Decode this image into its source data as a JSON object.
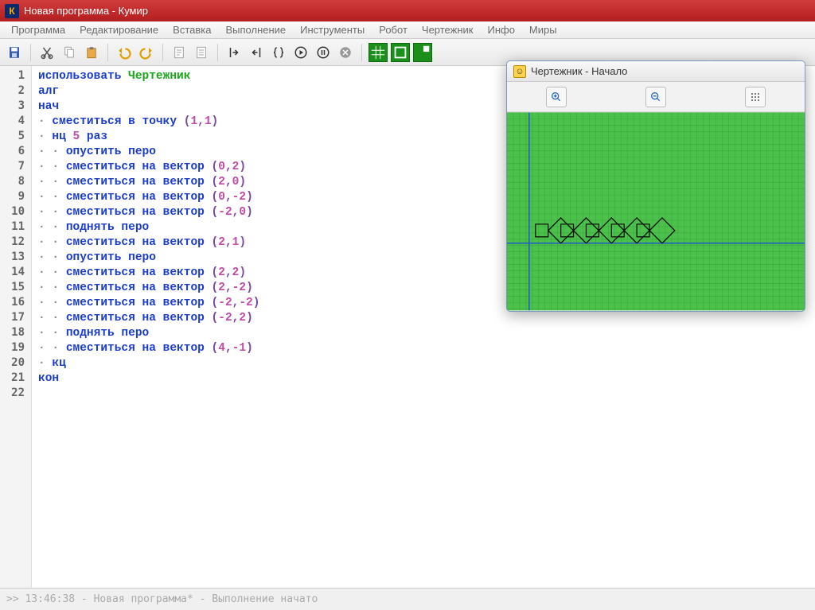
{
  "window": {
    "title": "Новая программа - Кумир",
    "icon_letter": "К"
  },
  "menu": {
    "items": [
      "Программа",
      "Редактирование",
      "Вставка",
      "Выполнение",
      "Инструменты",
      "Робот",
      "Чертежник",
      "Инфо",
      "Миры"
    ]
  },
  "toolbar": {
    "icons": [
      "save",
      "cut",
      "copy",
      "paste",
      "undo",
      "redo",
      "indent",
      "outdent",
      "step-in",
      "step-out",
      "braces",
      "run",
      "stop",
      "cancel"
    ],
    "green_icons": [
      "grid",
      "border",
      "fill"
    ]
  },
  "code": {
    "lines": [
      {
        "n": 1,
        "raw": [
          [
            "kw",
            "использовать "
          ],
          [
            "id",
            "Чертежник"
          ]
        ]
      },
      {
        "n": 2,
        "raw": [
          [
            "kw",
            "алг"
          ]
        ]
      },
      {
        "n": 3,
        "raw": [
          [
            "kw",
            "нач"
          ]
        ]
      },
      {
        "n": 4,
        "raw": [
          [
            "dot",
            "· "
          ],
          [
            "kw",
            "сместиться в точку "
          ],
          [
            "pn",
            "("
          ],
          [
            "num",
            "1"
          ],
          [
            "pn",
            ","
          ],
          [
            "num",
            "1"
          ],
          [
            "pn",
            ")"
          ]
        ]
      },
      {
        "n": 5,
        "raw": [
          [
            "dot",
            "· "
          ],
          [
            "kw",
            "нц "
          ],
          [
            "num",
            "5"
          ],
          [
            "kw",
            " раз"
          ]
        ]
      },
      {
        "n": 6,
        "raw": [
          [
            "dot",
            "· · "
          ],
          [
            "kw",
            "опустить перо"
          ]
        ]
      },
      {
        "n": 7,
        "raw": [
          [
            "dot",
            "· · "
          ],
          [
            "kw",
            "сместиться на вектор "
          ],
          [
            "pn",
            "("
          ],
          [
            "num",
            "0"
          ],
          [
            "pn",
            ","
          ],
          [
            "num",
            "2"
          ],
          [
            "pn",
            ")"
          ]
        ]
      },
      {
        "n": 8,
        "raw": [
          [
            "dot",
            "· · "
          ],
          [
            "kw",
            "сместиться на вектор "
          ],
          [
            "pn",
            "("
          ],
          [
            "num",
            "2"
          ],
          [
            "pn",
            ","
          ],
          [
            "num",
            "0"
          ],
          [
            "pn",
            ")"
          ]
        ]
      },
      {
        "n": 9,
        "raw": [
          [
            "dot",
            "· · "
          ],
          [
            "kw",
            "сместиться на вектор "
          ],
          [
            "pn",
            "("
          ],
          [
            "num",
            "0"
          ],
          [
            "pn",
            ","
          ],
          [
            "num",
            "-2"
          ],
          [
            "pn",
            ")"
          ]
        ]
      },
      {
        "n": 10,
        "raw": [
          [
            "dot",
            "· · "
          ],
          [
            "kw",
            "сместиться на вектор "
          ],
          [
            "pn",
            "("
          ],
          [
            "num",
            "-2"
          ],
          [
            "pn",
            ","
          ],
          [
            "num",
            "0"
          ],
          [
            "pn",
            ")"
          ]
        ]
      },
      {
        "n": 11,
        "raw": [
          [
            "dot",
            "· · "
          ],
          [
            "kw",
            "поднять перо"
          ]
        ]
      },
      {
        "n": 12,
        "raw": [
          [
            "dot",
            "· · "
          ],
          [
            "kw",
            "сместиться на вектор "
          ],
          [
            "pn",
            "("
          ],
          [
            "num",
            "2"
          ],
          [
            "pn",
            ","
          ],
          [
            "num",
            "1"
          ],
          [
            "pn",
            ")"
          ]
        ]
      },
      {
        "n": 13,
        "raw": [
          [
            "dot",
            "· · "
          ],
          [
            "kw",
            "опустить перо"
          ]
        ]
      },
      {
        "n": 14,
        "raw": [
          [
            "dot",
            "· · "
          ],
          [
            "kw",
            "сместиться на вектор "
          ],
          [
            "pn",
            "("
          ],
          [
            "num",
            "2"
          ],
          [
            "pn",
            ","
          ],
          [
            "num",
            "2"
          ],
          [
            "pn",
            ")"
          ]
        ]
      },
      {
        "n": 15,
        "raw": [
          [
            "dot",
            "· · "
          ],
          [
            "kw",
            "сместиться на вектор "
          ],
          [
            "pn",
            "("
          ],
          [
            "num",
            "2"
          ],
          [
            "pn",
            ","
          ],
          [
            "num",
            "-2"
          ],
          [
            "pn",
            ")"
          ]
        ]
      },
      {
        "n": 16,
        "raw": [
          [
            "dot",
            "· · "
          ],
          [
            "kw",
            "сместиться на вектор "
          ],
          [
            "pn",
            "("
          ],
          [
            "num",
            "-2"
          ],
          [
            "pn",
            ","
          ],
          [
            "num",
            "-2"
          ],
          [
            "pn",
            ")"
          ]
        ]
      },
      {
        "n": 17,
        "raw": [
          [
            "dot",
            "· · "
          ],
          [
            "kw",
            "сместиться на вектор "
          ],
          [
            "pn",
            "("
          ],
          [
            "num",
            "-2"
          ],
          [
            "pn",
            ","
          ],
          [
            "num",
            "2"
          ],
          [
            "pn",
            ")"
          ]
        ]
      },
      {
        "n": 18,
        "raw": [
          [
            "dot",
            "· · "
          ],
          [
            "kw",
            "поднять перо"
          ]
        ]
      },
      {
        "n": 19,
        "raw": [
          [
            "dot",
            "· · "
          ],
          [
            "kw",
            "сместиться на вектор "
          ],
          [
            "pn",
            "("
          ],
          [
            "num",
            "4"
          ],
          [
            "pn",
            ","
          ],
          [
            "num",
            "-1"
          ],
          [
            "pn",
            ")"
          ]
        ]
      },
      {
        "n": 20,
        "raw": [
          [
            "dot",
            "· "
          ],
          [
            "kw",
            "кц"
          ]
        ]
      },
      {
        "n": 21,
        "raw": [
          [
            "kw",
            "кон"
          ]
        ]
      },
      {
        "n": 22,
        "raw": []
      }
    ]
  },
  "drawer": {
    "title": "Чертежник - Начало",
    "tools": [
      "zoom-in",
      "zoom-out",
      "grid-toggle"
    ]
  },
  "status": {
    "text": ">> 13:46:38 - Новая программа* - Выполнение начато"
  }
}
